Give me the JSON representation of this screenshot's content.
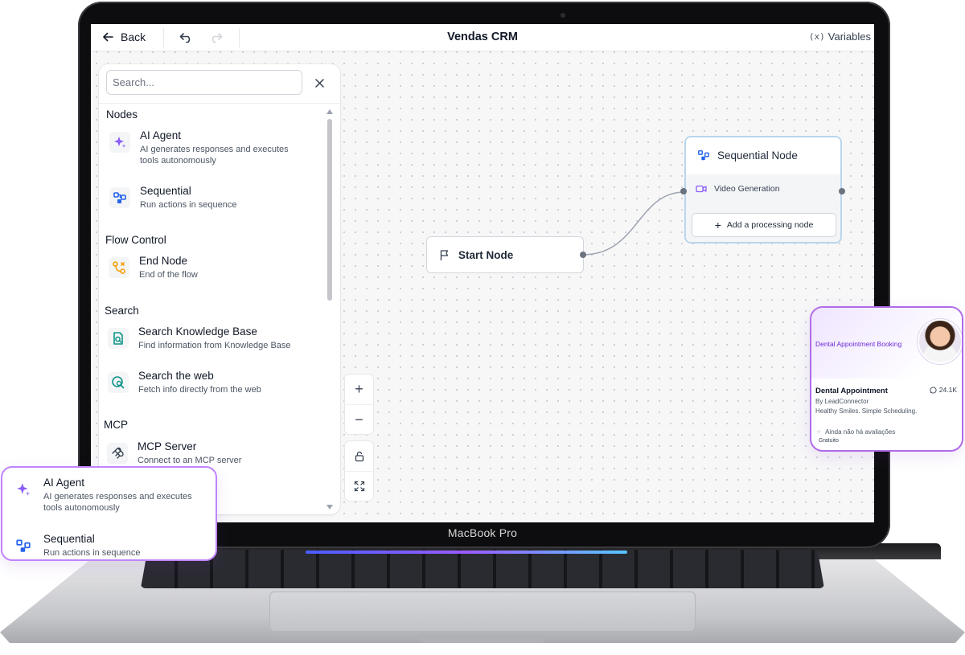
{
  "device": {
    "label": "MacBook Pro"
  },
  "topbar": {
    "back_label": "Back",
    "title": "Vendas CRM",
    "variables_prefix": "(x)",
    "variables_label": "Variables"
  },
  "sidebar": {
    "search_placeholder": "Search...",
    "sections": [
      {
        "title": "Nodes",
        "items": [
          {
            "title": "AI Agent",
            "desc": "AI generates responses and executes tools autonomously",
            "icon": "sparkles-icon"
          },
          {
            "title": "Sequential",
            "desc": "Run actions in sequence",
            "icon": "sequence-icon"
          }
        ]
      },
      {
        "title": "Flow Control",
        "items": [
          {
            "title": "End Node",
            "desc": "End of the flow",
            "icon": "flow-end-icon"
          }
        ]
      },
      {
        "title": "Search",
        "items": [
          {
            "title": "Search Knowledge Base",
            "desc": "Find information from Knowledge Base",
            "icon": "knowledge-search-icon"
          },
          {
            "title": "Search the web",
            "desc": "Fetch info directly from the web",
            "icon": "web-search-icon"
          }
        ]
      },
      {
        "title": "MCP",
        "items": [
          {
            "title": "MCP Server",
            "desc": "Connect to an MCP server",
            "icon": "mcp-icon"
          }
        ]
      }
    ]
  },
  "canvas": {
    "start_node": {
      "label": "Start Node"
    },
    "sequential_node": {
      "label": "Sequential Node",
      "child": "Video Generation",
      "add_label": "Add a processing node"
    },
    "controls": {
      "zoom_in": "+",
      "zoom_out": "−"
    }
  },
  "popup": {
    "items": [
      {
        "title": "AI Agent",
        "desc": "AI generates responses and executes tools autonomously"
      },
      {
        "title": "Sequential",
        "desc": "Run actions in sequence"
      }
    ]
  },
  "app_card": {
    "hero_title": "Dental Appointment Booking",
    "title": "Dental Appointment",
    "count": "24.1K",
    "by": "By LeadConnector",
    "tagline": "Healthy Smiles. Simple Scheduling.",
    "rating": "Ainda não há avaliações",
    "price": "Gratuito"
  },
  "colors": {
    "accent_purple": "#8b5cf6",
    "accent_blue": "#2563eb",
    "node_border": "#b8d6ee",
    "end_node_orange": "#f59e0b",
    "search_green": "#0d9488"
  }
}
